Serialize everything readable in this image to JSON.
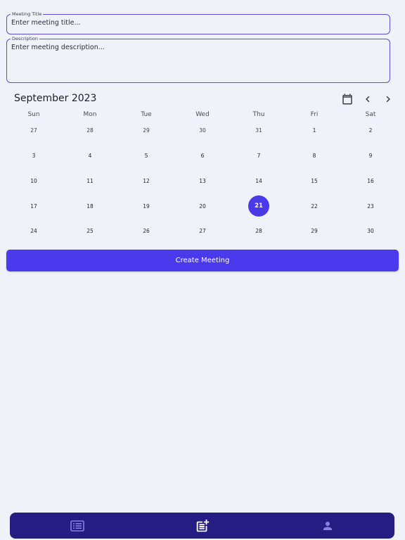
{
  "form": {
    "title_label": "Meeting Title",
    "title_placeholder": "Enter meeting title...",
    "description_label": "Description",
    "description_placeholder": "Enter meeting description..."
  },
  "calendar": {
    "month_label": "September 2023",
    "weekdays": [
      "Sun",
      "Mon",
      "Tue",
      "Wed",
      "Thu",
      "Fri",
      "Sat"
    ],
    "weeks": [
      [
        "27",
        "28",
        "29",
        "30",
        "31",
        "1",
        "2"
      ],
      [
        "3",
        "4",
        "5",
        "6",
        "7",
        "8",
        "9"
      ],
      [
        "10",
        "11",
        "12",
        "13",
        "14",
        "15",
        "16"
      ],
      [
        "17",
        "18",
        "19",
        "20",
        "21",
        "22",
        "23"
      ],
      [
        "24",
        "25",
        "26",
        "27",
        "28",
        "29",
        "30"
      ]
    ],
    "outside_month_days": [
      "27",
      "28",
      "29",
      "30",
      "31"
    ],
    "selected_day": "21",
    "icons": [
      "calendar-icon",
      "chevron-left-icon",
      "chevron-right-icon"
    ]
  },
  "actions": {
    "create_label": "Create Meeting"
  },
  "bottom_nav": {
    "items": [
      "list-icon",
      "post-add-icon",
      "person-icon"
    ],
    "active": "post-add-icon"
  },
  "colors": {
    "accent": "#4b39ee",
    "nav_bg": "#261d82",
    "background": "#eff2f8"
  }
}
